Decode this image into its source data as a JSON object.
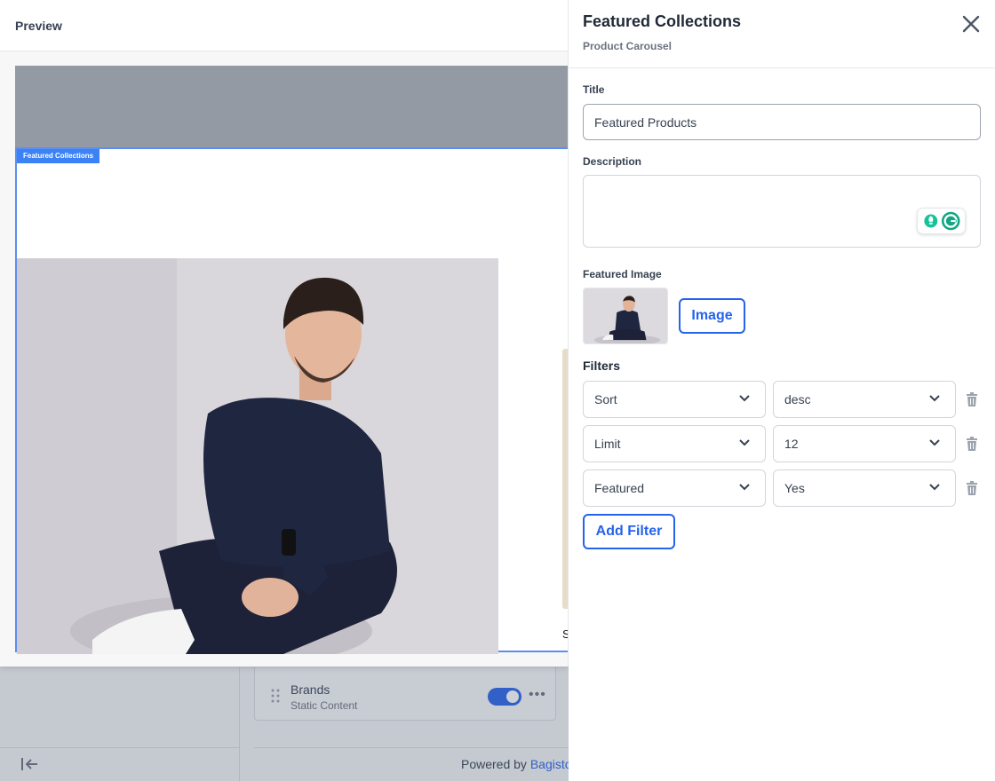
{
  "background": {
    "brand_card": {
      "title": "Brands",
      "subtitle": "Static Content",
      "enabled": true
    },
    "footer": {
      "powered_prefix": "Powered by",
      "powered_link": "Bagisto"
    }
  },
  "preview": {
    "title": "Preview",
    "section_tag": "Featured Collections",
    "next_card_letter": "S"
  },
  "panel": {
    "title": "Featured Collections",
    "subtitle": "Product Carousel",
    "title_label": "Title",
    "title_value": "Featured Products",
    "description_label": "Description",
    "description_value": "",
    "featured_image_label": "Featured Image",
    "image_button": "Image",
    "filters_label": "Filters",
    "filters": [
      {
        "key": "Sort",
        "value": "desc"
      },
      {
        "key": "Limit",
        "value": "12"
      },
      {
        "key": "Featured",
        "value": "Yes"
      }
    ],
    "add_filter_button": "Add Filter"
  },
  "colors": {
    "accent": "#2563eb",
    "section_outline": "#5b8ef0",
    "banner": "#949aa3"
  },
  "icons": [
    "close-icon",
    "chevron-down-icon",
    "trash-icon",
    "grammarly-icon",
    "collapse-sidebar-icon",
    "drag-handle-icon",
    "more-icon"
  ]
}
